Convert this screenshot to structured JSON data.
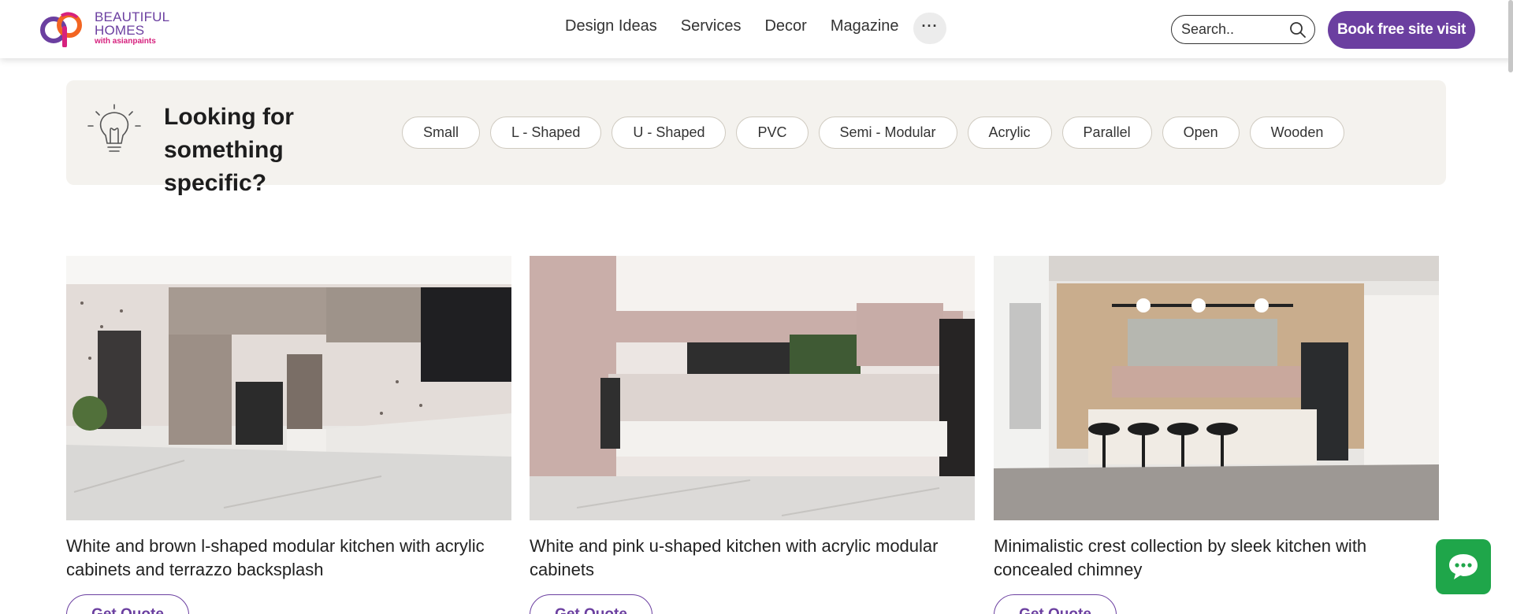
{
  "header": {
    "logo": {
      "line1": "BEAUTIFUL",
      "line2": "HOMES",
      "line3": "with asianpaints"
    },
    "nav": [
      "Design Ideas",
      "Services",
      "Decor",
      "Magazine"
    ],
    "more_label": "···",
    "search_placeholder": "Search..",
    "book_label": "Book free site visit"
  },
  "filter": {
    "title": "Looking for something specific?",
    "chips": [
      "Small",
      "L - Shaped",
      "U - Shaped",
      "PVC",
      "Semi - Modular",
      "Acrylic",
      "Parallel",
      "Open",
      "Wooden"
    ]
  },
  "cards": [
    {
      "title": "White and brown l-shaped modular kitchen with acrylic cabinets and terrazzo backsplash",
      "cta": "Get Quote"
    },
    {
      "title": "White and pink u-shaped kitchen with acrylic modular cabinets",
      "cta": "Get Quote"
    },
    {
      "title": "Minimalistic crest collection by sleek kitchen with concealed chimney",
      "cta": "Get Quote"
    }
  ],
  "colors": {
    "brand": "#6b3fa0",
    "accent_pink": "#d6217e",
    "chat_green": "#1fa64a",
    "filter_bg": "#f4f2ee"
  },
  "icons": [
    "search-icon",
    "bulb-icon",
    "chat-icon",
    "more-icon"
  ]
}
